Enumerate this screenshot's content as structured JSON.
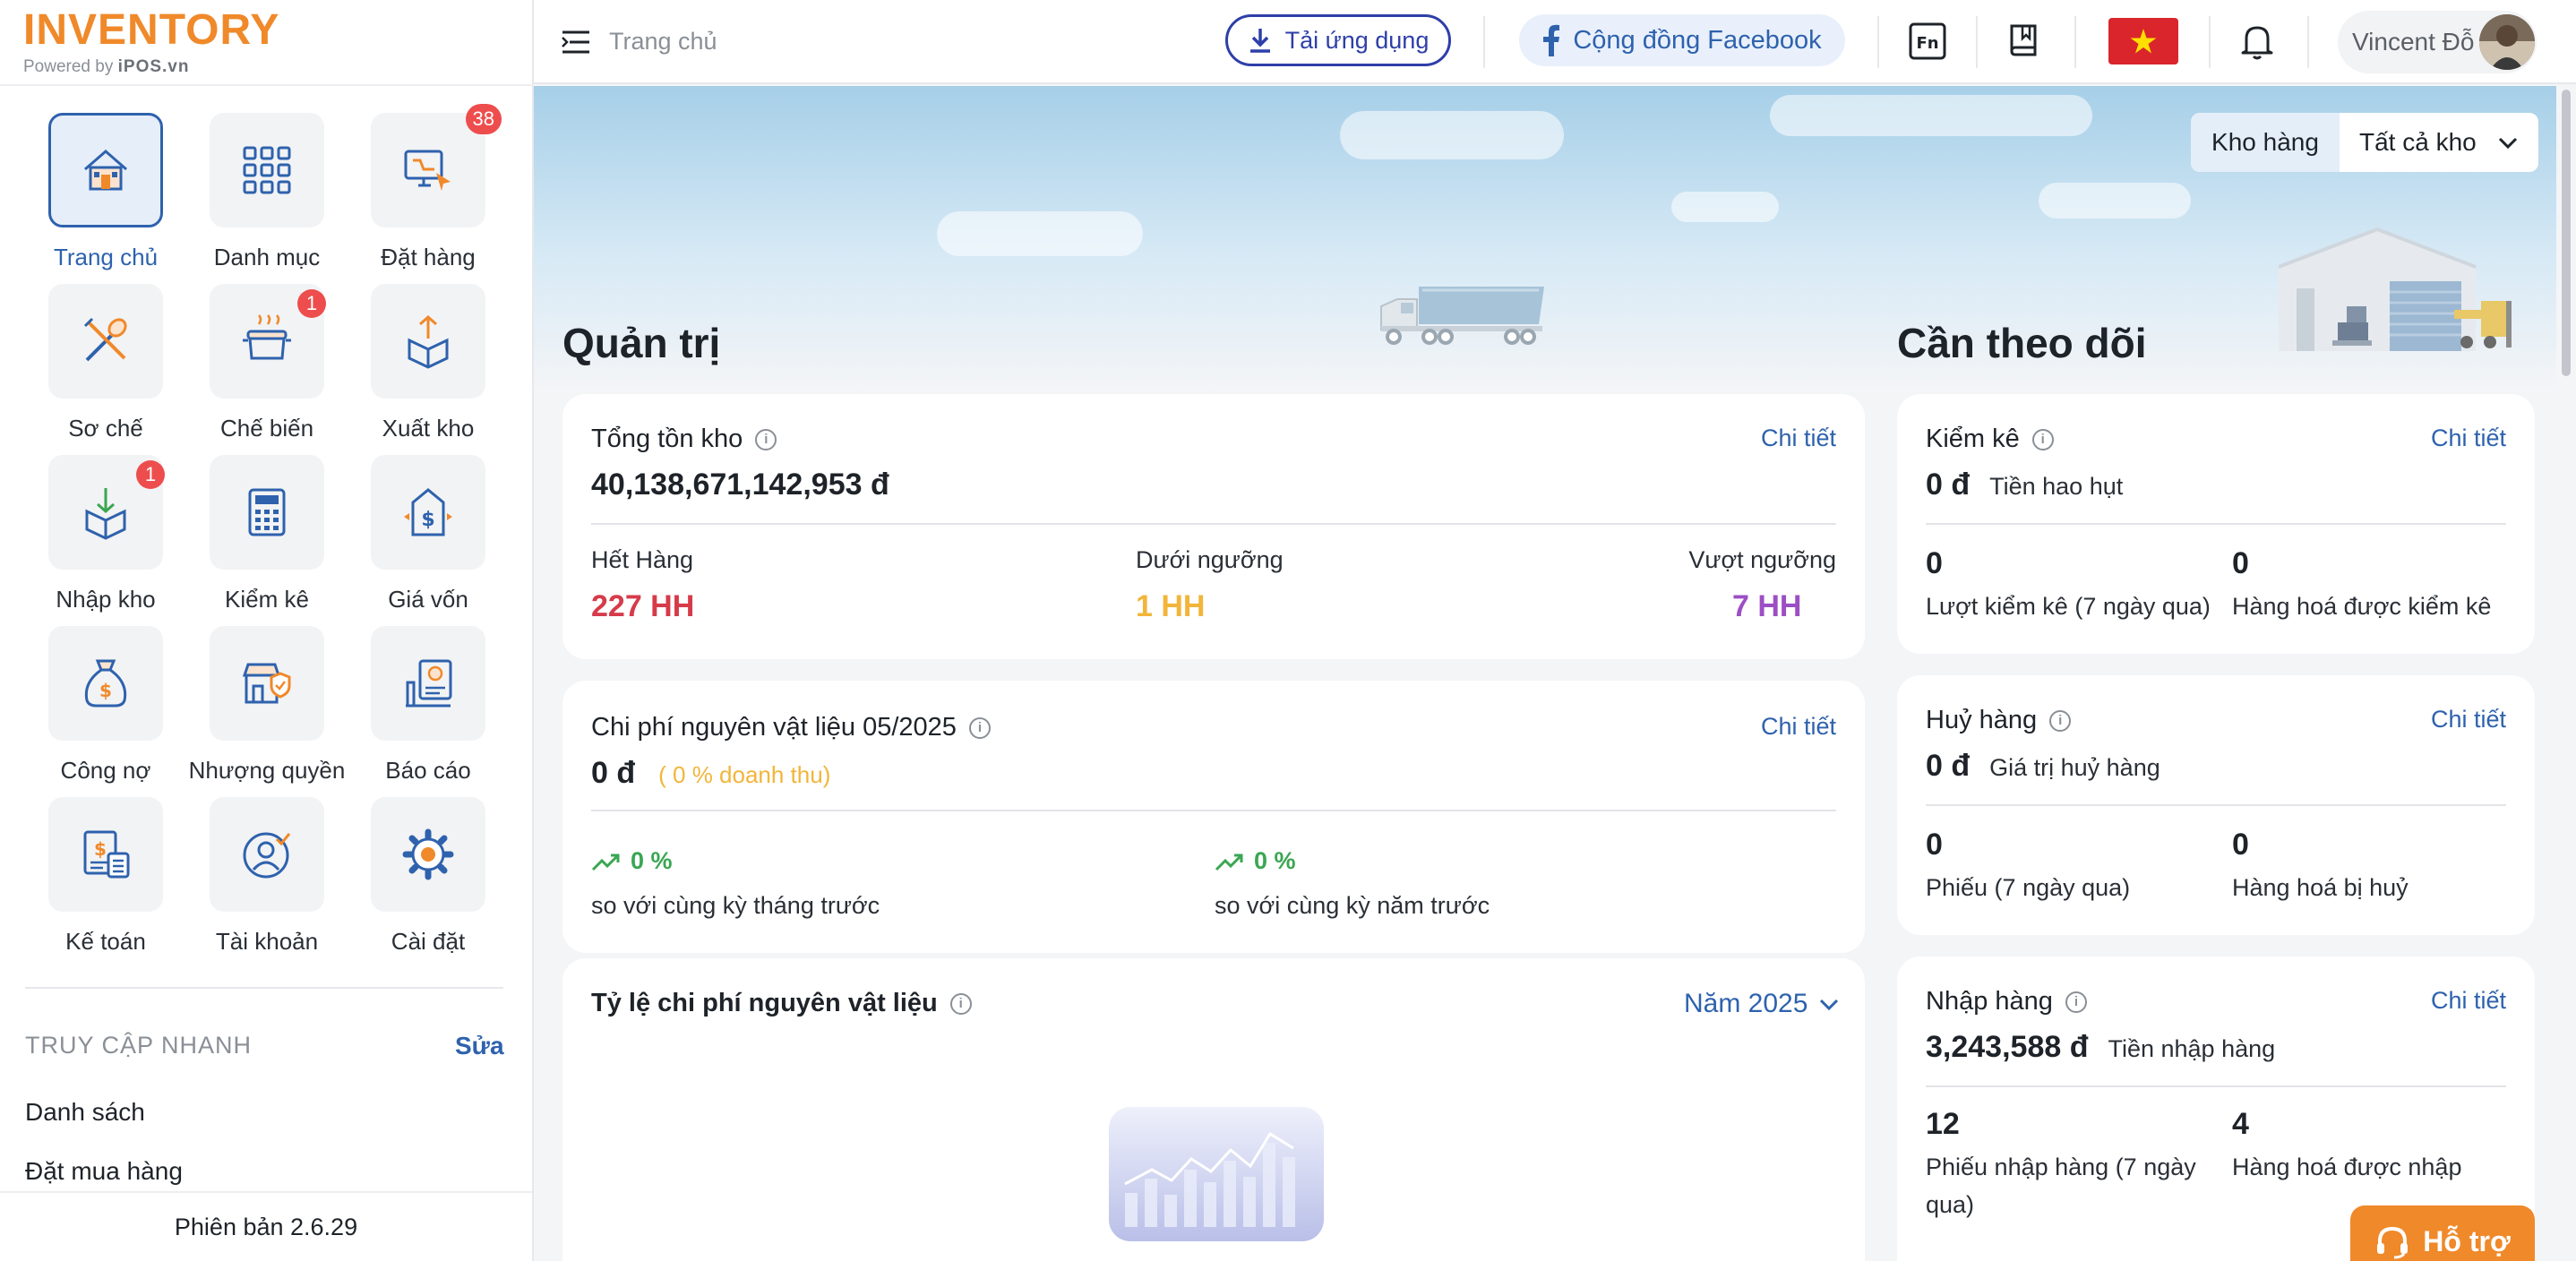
{
  "logo": {
    "brand": "INVENTORY",
    "powered_by": "Powered by",
    "powered_brand": "iPOS.vn"
  },
  "sidebar": {
    "menu": [
      {
        "label": "Trang chủ",
        "icon": "home-icon",
        "badge": ""
      },
      {
        "label": "Danh mục",
        "icon": "grid-icon",
        "badge": ""
      },
      {
        "label": "Đặt hàng",
        "icon": "monitor-cursor-icon",
        "badge": "38"
      },
      {
        "label": "Sơ chế",
        "icon": "tools-icon",
        "badge": ""
      },
      {
        "label": "Chế biến",
        "icon": "cooking-pot-icon",
        "badge": "1"
      },
      {
        "label": "Xuất kho",
        "icon": "box-export-icon",
        "badge": ""
      },
      {
        "label": "Nhập kho",
        "icon": "box-import-icon",
        "badge": "1"
      },
      {
        "label": "Kiểm kê",
        "icon": "calculator-icon",
        "badge": ""
      },
      {
        "label": "Giá vốn",
        "icon": "price-tag-icon",
        "badge": ""
      },
      {
        "label": "Công nợ",
        "icon": "money-bag-icon",
        "badge": ""
      },
      {
        "label": "Nhượng quyền",
        "icon": "store-shield-icon",
        "badge": ""
      },
      {
        "label": "Báo cáo",
        "icon": "report-icon",
        "badge": ""
      },
      {
        "label": "Kế toán",
        "icon": "accounting-icon",
        "badge": ""
      },
      {
        "label": "Tài khoản",
        "icon": "account-icon",
        "badge": ""
      },
      {
        "label": "Cài đặt",
        "icon": "gear-icon",
        "badge": ""
      }
    ],
    "quick_access_title": "TRUY CẬP NHANH",
    "quick_access_edit": "Sửa",
    "quick_links": [
      "Danh sách",
      "Đặt mua hàng"
    ],
    "version": "Phiên bản 2.6.29"
  },
  "header": {
    "breadcrumb": "Trang chủ",
    "download_app": "Tải ứng dụng",
    "facebook_community": "Cộng đồng Facebook",
    "user_name": "Vincent Đỗ"
  },
  "warehouse": {
    "label": "Kho hàng",
    "value": "Tất cả kho"
  },
  "admin": {
    "title": "Quản trị",
    "stock": {
      "title": "Tổng tồn kho",
      "detail": "Chi tiết",
      "total": "40,138,671,142,953 đ",
      "out_of_stock_label": "Hết Hàng",
      "out_of_stock_value": "227 HH",
      "below_label": "Dưới ngưỡng",
      "below_value": "1 HH",
      "above_label": "Vượt ngưỡng",
      "above_value": "7 HH"
    },
    "material_cost": {
      "title": "Chi phí nguyên vật liệu 05/2025",
      "detail": "Chi tiết",
      "value": "0 đ",
      "note": "( 0 % doanh thu)",
      "month_change": "0 %",
      "month_label": "so với cùng kỳ tháng trước",
      "year_change": "0 %",
      "year_label": "so với cùng kỳ năm trước"
    },
    "material_ratio": {
      "title": "Tỷ lệ chi phí nguyên vật liệu",
      "year": "Năm 2025"
    }
  },
  "watch": {
    "title": "Cần theo dõi",
    "inventory_check": {
      "title": "Kiểm kê",
      "detail": "Chi tiết",
      "value": "0 đ",
      "value_label": "Tiền hao hụt",
      "count1": "0",
      "label1": "Lượt kiểm kê (7 ngày qua)",
      "count2": "0",
      "label2": "Hàng hoá được kiểm kê"
    },
    "disposal": {
      "title": "Huỷ hàng",
      "detail": "Chi tiết",
      "value": "0 đ",
      "value_label": "Giá trị huỷ hàng",
      "count1": "0",
      "label1": "Phiếu (7 ngày qua)",
      "count2": "0",
      "label2": "Hàng hoá bị huỷ"
    },
    "import": {
      "title": "Nhập hàng",
      "detail": "Chi tiết",
      "value": "3,243,588 đ",
      "value_label": "Tiền nhập hàng",
      "count1": "12",
      "label1a": "Phiếu nhập hàng (7 ngày",
      "label1b": "qua)",
      "count2": "4",
      "label2": "Hàng hoá được nhập"
    }
  },
  "support": "Hỗ trợ",
  "colors": {
    "primary": "#2e62ad",
    "accent": "#f0892a",
    "danger": "#d63b4a",
    "warning": "#f2b53a",
    "purple": "#9c4fc4",
    "success": "#3aa652"
  }
}
